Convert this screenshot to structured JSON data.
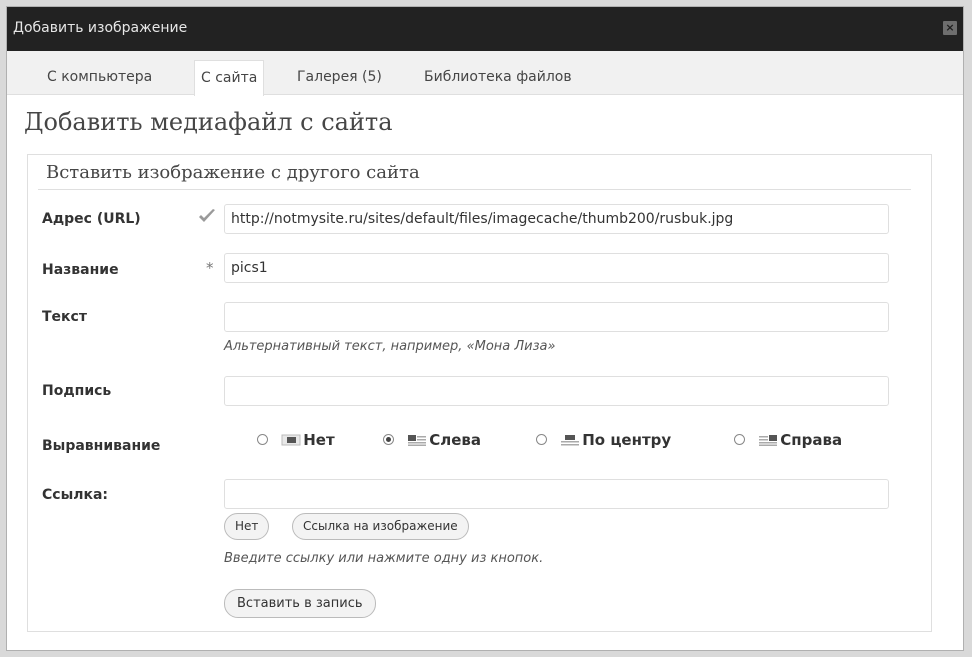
{
  "dialog": {
    "title": "Добавить изображение",
    "close_glyph": "×"
  },
  "tabs": [
    {
      "label": "С компьютера",
      "active": false
    },
    {
      "label": "С сайта",
      "active": true
    },
    {
      "label": "Галерея (5)",
      "active": false
    },
    {
      "label": "Библиотека файлов",
      "active": false
    }
  ],
  "page": {
    "heading": "Добавить медиафайл с сайта",
    "section_title": "Вставить изображение с другого сайта"
  },
  "form": {
    "url": {
      "label": "Адрес (URL)",
      "value": "http://notmysite.ru/sites/default/files/imagecache/thumb200/rusbuk.jpg",
      "status_icon": "checkmark-icon"
    },
    "title": {
      "label": "Название",
      "required_mark": "*",
      "value": "pics1"
    },
    "alt": {
      "label": "Текст",
      "value": "",
      "hint": "Альтернативный текст, например, «Мона Лиза»"
    },
    "caption": {
      "label": "Подпись",
      "value": ""
    },
    "align": {
      "label": "Выравнивание",
      "options": [
        {
          "label": "Нет",
          "icon": "align-none-icon",
          "selected": false
        },
        {
          "label": "Слева",
          "icon": "align-left-icon",
          "selected": true
        },
        {
          "label": "По центру",
          "icon": "align-center-icon",
          "selected": false
        },
        {
          "label": "Справа",
          "icon": "align-right-icon",
          "selected": false
        }
      ]
    },
    "link": {
      "label": "Ссылка:",
      "value": "",
      "none_button": "Нет",
      "image_link_button": "Ссылка на изображение",
      "hint": "Введите ссылку или нажмите одну из кнопок."
    },
    "submit_button": "Вставить в запись"
  },
  "colors": {
    "titlebar": "#222222",
    "tabbar": "#f1f1f1",
    "border": "#dfdfdf",
    "text": "#333333"
  }
}
